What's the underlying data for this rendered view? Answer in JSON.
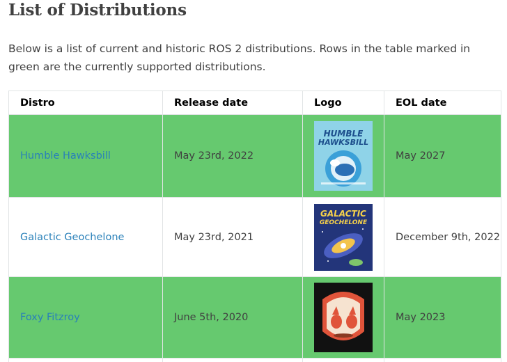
{
  "page": {
    "title": "List of Distributions",
    "intro": "Below is a list of current and historic ROS 2 distributions. Rows in the table marked in green are the currently supported distributions."
  },
  "table": {
    "headers": {
      "distro": "Distro",
      "release_date": "Release date",
      "logo": "Logo",
      "eol_date": "EOL date"
    },
    "rows": [
      {
        "distro": "Humble Hawksbill",
        "release_date": "May 23rd, 2022",
        "eol_date": "May 2027",
        "supported": true,
        "logo": {
          "icon": "humble-hawksbill-logo",
          "line1": "HUMBLE",
          "line2": "HAWKSBILL"
        }
      },
      {
        "distro": "Galactic Geochelone",
        "release_date": "May 23rd, 2021",
        "eol_date": "December 9th, 2022",
        "supported": false,
        "logo": {
          "icon": "galactic-geochelone-logo",
          "line1": "GALACTIC",
          "line2": "GEOCHELONE"
        }
      },
      {
        "distro": "Foxy Fitzroy",
        "release_date": "June 5th, 2020",
        "eol_date": "May 2023",
        "supported": true,
        "logo": {
          "icon": "foxy-fitzroy-logo"
        }
      }
    ]
  },
  "colors": {
    "supported_row": "#66c96f",
    "link": "#2980b9",
    "border": "#e1e4e5"
  }
}
